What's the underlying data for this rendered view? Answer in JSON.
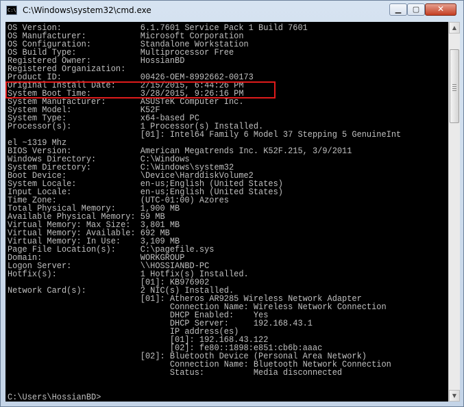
{
  "window": {
    "title": "C:\\Windows\\system32\\cmd.exe",
    "icon": "cmd-icon",
    "controls": {
      "minimize_icon": "minimize-icon",
      "maximize_icon": "maximize-icon",
      "close_icon": "close-icon"
    }
  },
  "console": {
    "text_color": "#c0c0c0",
    "background": "#000000",
    "highlight_color": "#e01b1b",
    "lines": [
      "OS Version:                6.1.7601 Service Pack 1 Build 7601",
      "OS Manufacturer:           Microsoft Corporation",
      "OS Configuration:          Standalone Workstation",
      "OS Build Type:             Multiprocessor Free",
      "Registered Owner:          HossianBD",
      "Registered Organization:",
      "Product ID:                00426-OEM-8992662-00173",
      "Original Install Date:     2/15/2015, 6:44:26 PM",
      "System Boot Time:          3/28/2015, 9:26:16 PM",
      "System Manufacturer:       ASUSTeK Computer Inc.",
      "System Model:              K52F",
      "System Type:               x64-based PC",
      "Processor(s):              1 Processor(s) Installed.",
      "                           [01]: Intel64 Family 6 Model 37 Stepping 5 GenuineInt",
      "el ~1319 Mhz",
      "BIOS Version:              American Megatrends Inc. K52F.215, 3/9/2011",
      "Windows Directory:         C:\\Windows",
      "System Directory:          C:\\Windows\\system32",
      "Boot Device:               \\Device\\HarddiskVolume2",
      "System Locale:             en-us;English (United States)",
      "Input Locale:              en-us;English (United States)",
      "Time Zone:                 (UTC-01:00) Azores",
      "Total Physical Memory:     1,900 MB",
      "Available Physical Memory: 59 MB",
      "Virtual Memory: Max Size:  3,801 MB",
      "Virtual Memory: Available: 692 MB",
      "Virtual Memory: In Use:    3,109 MB",
      "Page File Location(s):     C:\\pagefile.sys",
      "Domain:                    WORKGROUP",
      "Logon Server:              \\\\HOSSIANBD-PC",
      "Hotfix(s):                 1 Hotfix(s) Installed.",
      "                           [01]: KB976902",
      "Network Card(s):           2 NIC(s) Installed.",
      "                           [01]: Atheros AR9285 Wireless Network Adapter",
      "                                 Connection Name: Wireless Network Connection",
      "                                 DHCP Enabled:    Yes",
      "                                 DHCP Server:     192.168.43.1",
      "                                 IP address(es)",
      "                                 [01]: 192.168.43.122",
      "                                 [02]: fe80::1898:e851:cb6b:aaac",
      "                           [02]: Bluetooth Device (Personal Area Network)",
      "                                 Connection Name: Bluetooth Network Connection",
      "                                 Status:          Media disconnected",
      "",
      "",
      "C:\\Users\\HossianBD>"
    ]
  },
  "scrollbar": {
    "up_icon": "scroll-up-arrow-icon",
    "down_icon": "scroll-down-arrow-icon"
  }
}
